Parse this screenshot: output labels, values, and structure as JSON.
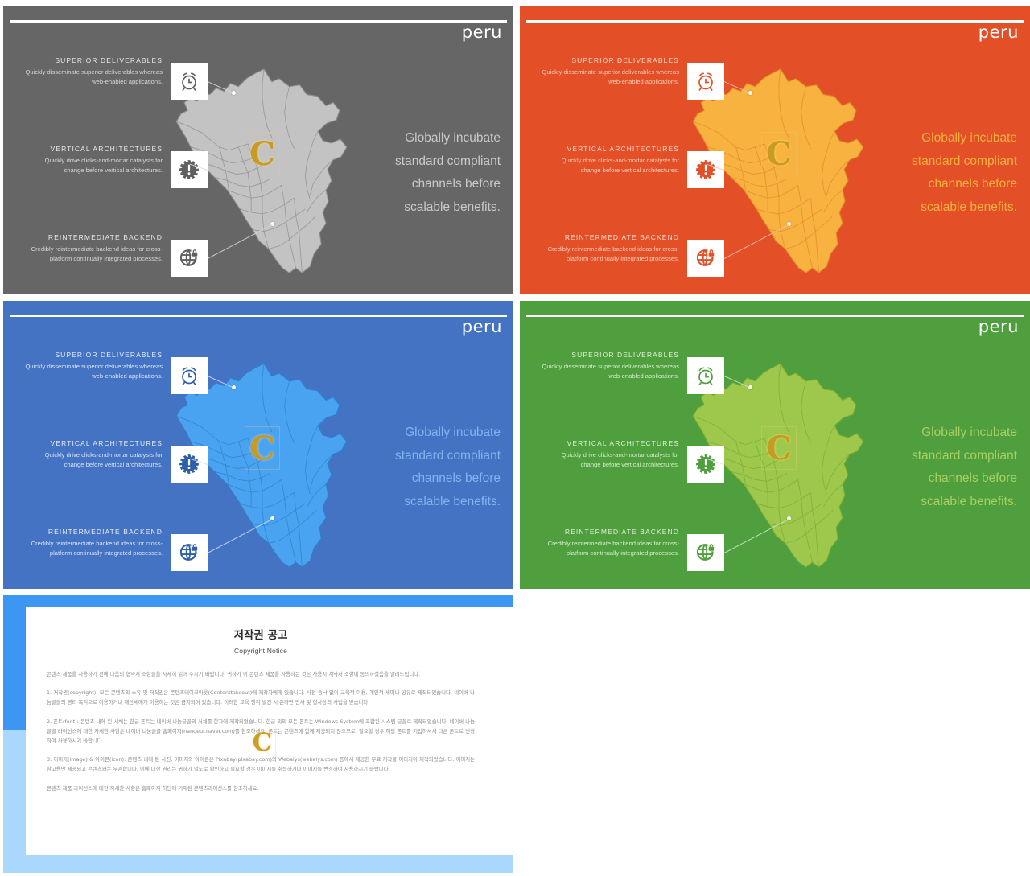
{
  "deck": {
    "title": "peru",
    "right_copy": "Globally incubate standard compliant channels before scalable benefits.",
    "right_copy_lines": [
      "Globally incubate",
      "standard compliant",
      "channels before",
      "scalable benefits."
    ],
    "features": [
      {
        "id": "superior-deliverables",
        "title": "SUPERIOR  DELIVERABLES",
        "body": "Quickly disseminate superior deliverables whereas web-enabled applications.",
        "icon": "alarm-clock-icon"
      },
      {
        "id": "vertical-architectures",
        "title": "VERTICAL  ARCHITECTURES",
        "body": "Quickly drive clicks-and-mortar catalysts for change before vertical architectures.",
        "icon": "gear-alert-icon"
      },
      {
        "id": "reintermediate-backend",
        "title": "REINTERMEDIATE  BACKEND",
        "body": "Credibly reintermediate backend ideas for cross-platform continually integrated processes.",
        "icon": "globe-lock-icon"
      }
    ],
    "watermark_letter": "C"
  },
  "slides": [
    {
      "name": "slide-gray",
      "bg": "#666666",
      "map_fill": "#c3c3c3",
      "map_stroke": "#8e8e8e",
      "title_color": "#ffffff",
      "feature_title_color": "#e8e8e8",
      "feature_body_color": "#d6d6d6",
      "icon_color": "#5f5f5f",
      "copy_color": "#c9c9c9",
      "line_color": "#d8d8d8"
    },
    {
      "name": "slide-orange",
      "bg": "#e34f26",
      "map_fill": "#f7b23f",
      "map_stroke": "#e08a2a",
      "title_color": "#ffffff",
      "feature_title_color": "#ffd9cc",
      "feature_body_color": "#ffcbb8",
      "icon_color": "#e34f26",
      "copy_color": "#f7b23f",
      "line_color": "#f6c0ae"
    },
    {
      "name": "slide-blue",
      "bg": "#4573c4",
      "map_fill": "#4aa3f0",
      "map_stroke": "#2f7fcb",
      "title_color": "#ffffff",
      "feature_title_color": "#e4ecf9",
      "feature_body_color": "#d8e4f6",
      "icon_color": "#2f5fa8",
      "copy_color": "#7fb4ef",
      "line_color": "#cfdcf2"
    },
    {
      "name": "slide-green",
      "bg": "#4f9f3f",
      "map_fill": "#9dc84b",
      "map_stroke": "#7aab34",
      "title_color": "#ffffff",
      "feature_title_color": "#dff0d6",
      "feature_body_color": "#d4ecca",
      "icon_color": "#4f9f3f",
      "copy_color": "#a9cf62",
      "line_color": "#cfe7c4"
    }
  ],
  "document": {
    "heading_ko": "저작권 공고",
    "heading_en": "Copyright Notice",
    "watermark_letter": "C",
    "paragraphs": [
      "콘텐츠 제품을 사용하기 전에 다음의 협약서 조항들을 자세히 읽어 주시기 바랍니다. 귀하가 이 콘텐츠 제품을 사용하는 것은 사용시 계약서 조항에 동의하셨음을 알려드립니다.",
      "1. 저작권(copyright): 모든 콘텐츠의 소유 및 저작권은 콘텐츠테이크아웃(Contenttakeout)에 제작자에게 있습니다. 사전 승낙 없이 교육적 이용, 개인적 세미나 공유로 제작되었습니다. 네이버 나눔글꼴의 영리 목적으로 이용하거나 재산세에게 이용하는 것은 금지되어 있습니다. 이러한 교육 행위 발견 시 준하면 민사 및 형사상의 사법을 받습니다.",
      "2. 폰트(font): 콘텐츠 내에 된 서체는 한글 폰트는 네이버 나눔글꼴의 서체를 한자에 제작되었습니다. 한글 외의 모든 폰트는 Windows System에 포함된 시스템 글꼴로 제작되었습니다. 네이버 나눔글꼴 라이선스에 대한 자세한 사항은 네이버 나눔글꼴 홈페이지(hangeul.naver.com)를 참조하세요. 폰트는 콘텐츠에 함께 제공되지 않으므로, 필요할 경우 해당 폰트를 기업하셔서 다른 폰트로 변경하여 사용하시기 바랍니다.",
      "3. 이미지(image) & 아이콘(icon): 콘텐츠 내에 된 사진, 이미지와 아이콘은 Pixabay(pixabay.com)와 Webalys(webalys.com) 등에서 제공한 무료 저작물 이미지이 제작되었습니다. 이미지는 참고용만 제공되고 콘텐츠와는 무관합니다. 이에 대한 권리는 귀하가 별도로 확인하고 필요할 경우 이미지를 취득하거나 이미지를 변경하여 사용하시기 바랍니다.",
      "콘텐츠 제품 라이선스에 대한 자세한 사항은 홈페이지 하단에 기재된 콘텐츠라이선스를 참조하세요."
    ]
  }
}
